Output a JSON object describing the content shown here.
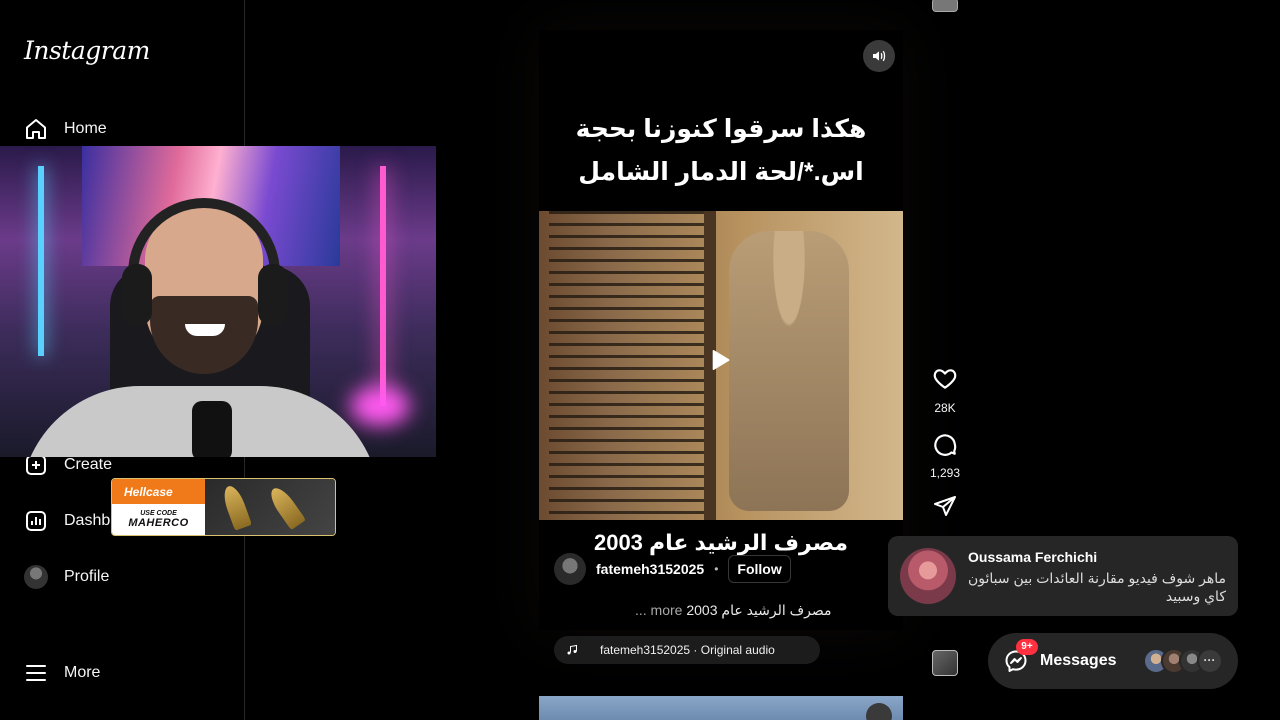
{
  "app": {
    "logo": "Instagram"
  },
  "sidebar": {
    "items": [
      {
        "label": "Home"
      },
      {
        "label": "Create"
      },
      {
        "label": "Dashb"
      },
      {
        "label": "Profile"
      },
      {
        "label": "More"
      }
    ]
  },
  "sponsor": {
    "brand": "Hellcase",
    "code_label": "USE CODE",
    "code": "MAHERCO"
  },
  "reel": {
    "title_arabic": "هكذا سرقوا كنوزنا بحجة اس.*/لحة الدمار الشامل",
    "caption_arabic": "مصرف الرشيد عام 2003",
    "author": "fatemeh3152025",
    "dot": "•",
    "follow_label": "Follow",
    "description": "مصرف الرشيد عام 2003",
    "more_label": "... more",
    "audio_label": "fatemeh3152025 · Original audio"
  },
  "actions": {
    "likes": "28K",
    "comments": "1,293"
  },
  "notification": {
    "sender": "Oussama Ferchichi",
    "message": "ماهر شوف فيديو مقارنة العائدات بين سبائون كاي وسبيد"
  },
  "messages": {
    "label": "Messages",
    "badge": "9+",
    "more_dots": "···"
  },
  "colors": {
    "background": "#000000",
    "badge": "#ff3040",
    "sponsor_accent": "#f07a1a",
    "sponsor_border": "#d9c170"
  },
  "icons": {
    "home": "home-icon",
    "create": "plus-square-icon",
    "dashboard": "dashboard-icon",
    "profile": "avatar",
    "more": "menu-icon",
    "sound": "speaker-icon",
    "play": "play-icon",
    "like": "heart-icon",
    "comment": "comment-icon",
    "share": "send-icon",
    "music": "music-note-icon",
    "messenger": "messenger-icon"
  }
}
